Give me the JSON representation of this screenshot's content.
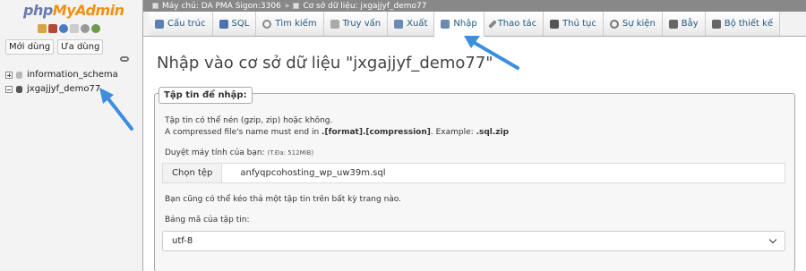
{
  "nav": {
    "logo_php": "php",
    "logo_ma": "MyAdmin",
    "tabs": [
      "Mới dùng",
      "Ưa dùng"
    ],
    "tree": [
      "information_schema",
      "jxgajjyf_demo77"
    ]
  },
  "breadcrumb": {
    "server": "Máy chủ: DA PMA Sigon:3306",
    "separator": "»",
    "database": "Cơ sở dữ liệu: jxgajjyf_demo77"
  },
  "menu": {
    "tabs": [
      {
        "label": "Cấu trúc",
        "icon": "structure-icon",
        "color": "#5a7fb5"
      },
      {
        "label": "SQL",
        "icon": "sql-icon",
        "color": "#4c72b0"
      },
      {
        "label": "Tìm kiếm",
        "icon": "search-icon",
        "color": "#888888"
      },
      {
        "label": "Truy vấn",
        "icon": "query-icon",
        "color": "#999999"
      },
      {
        "label": "Xuất",
        "icon": "export-icon",
        "color": "#6b8bb5"
      },
      {
        "label": "Nhập",
        "icon": "import-icon",
        "color": "#6b8bb5"
      },
      {
        "label": "Thao tác",
        "icon": "wrench-icon",
        "color": "#7a7a7a"
      },
      {
        "label": "Thủ tục",
        "icon": "routines-icon",
        "color": "#555555"
      },
      {
        "label": "Sự kiện",
        "icon": "clock-icon",
        "color": "#777777"
      },
      {
        "label": "Bẫy",
        "icon": "trigger-icon",
        "color": "#666666"
      },
      {
        "label": "Bộ thiết kế",
        "icon": "designer-icon",
        "color": "#666666"
      }
    ],
    "active": "Nhập"
  },
  "main": {
    "title": "Nhập vào cơ sở dữ liệu \"jxgajjyf_demo77\"",
    "legend": "Tập tin để nhập:",
    "compress_line1": "Tập tin có thể nén (gzip, zip) hoặc không.",
    "compress_line2_a": "A compressed file's name must end in ",
    "compress_line2_b": ".[format].[compression]",
    "compress_line2_c": ". Example: ",
    "compress_line2_d": ".sql.zip",
    "browse_label": "Duyệt máy tính của bạn: ",
    "browse_limit": "(T.Đa: 512MiB)",
    "choose_button": "Chọn tệp",
    "file_name": "anfyqpcohosting_wp_uw39m.sql",
    "drag_hint": "Bạn cũng có thể kéo thả một tập tin trên bất kỳ trang nào.",
    "charset_label": "Bảng mã của tập tin:",
    "charset_value": "utf-8"
  },
  "colors": {
    "arrow": "#3d8ede",
    "link": "#235a81"
  }
}
